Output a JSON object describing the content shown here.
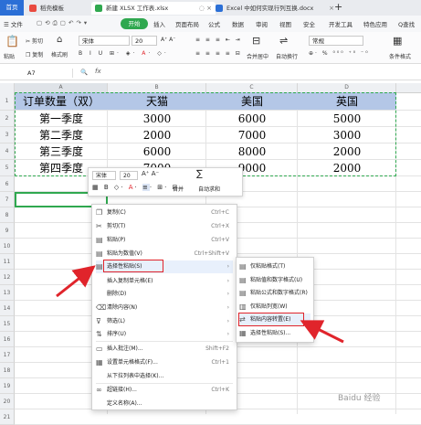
{
  "tabs": {
    "home": "首页",
    "wps": "稻壳模板",
    "xlsx": "新建 XLSX 工作表.xlsx",
    "docx": "Excel 中如何实现行列互换.docx",
    "plus": "+"
  },
  "menubar": {
    "file": "☰ 文件",
    "start": "开始",
    "items": [
      "插入",
      "页面布局",
      "公式",
      "数据",
      "审阅",
      "视图",
      "安全",
      "开发工具",
      "特色应用",
      "Q查找"
    ]
  },
  "ribbon": {
    "paste": "粘贴",
    "cut": "剪切",
    "copy": "复制",
    "format_painter": "格式刷",
    "font": "宋体",
    "font_size": "20",
    "merge": "合并居中",
    "wrap": "自动换行",
    "number_format": "常规",
    "cond": "条件格式"
  },
  "formula_bar": {
    "cell_ref": "A7",
    "fx": "fx"
  },
  "columns": [
    "A",
    "B",
    "C",
    "D"
  ],
  "rows": [
    "1",
    "2",
    "3",
    "4",
    "5",
    "6",
    "7",
    "8",
    "9",
    "10",
    "11",
    "12",
    "13",
    "14",
    "15",
    "16",
    "17",
    "18",
    "19",
    "20",
    "21"
  ],
  "table": {
    "headers": [
      "订单数量（双）",
      "天猫",
      "美国",
      "英国"
    ],
    "data": [
      [
        "第一季度",
        "3000",
        "6000",
        "5000"
      ],
      [
        "第二季度",
        "2000",
        "7000",
        "3000"
      ],
      [
        "第三季度",
        "6000",
        "8000",
        "2000"
      ],
      [
        "第四季度",
        "7000",
        "9000",
        "2000"
      ]
    ]
  },
  "mini_toolbar": {
    "font": "宋体",
    "size": "20",
    "merge": "合并",
    "autosum": "自动求和"
  },
  "context_menu": [
    {
      "label": "复制(C)",
      "shortcut": "Ctrl+C",
      "icon": "copy-icon"
    },
    {
      "label": "剪切(T)",
      "shortcut": "Ctrl+X",
      "icon": "cut-icon"
    },
    {
      "label": "粘贴(P)",
      "shortcut": "Ctrl+V",
      "icon": "paste-icon"
    },
    {
      "label": "粘贴为数值(V)",
      "shortcut": "Ctrl+Shift+V",
      "icon": "paste-values-icon"
    },
    {
      "label": "选择性粘贴(S)",
      "shortcut": "",
      "icon": "paste-special-icon",
      "submenu": true
    },
    {
      "label": "插入复制单元格(E)",
      "shortcut": "",
      "icon": "",
      "submenu": true
    },
    {
      "label": "删除(D)",
      "shortcut": "",
      "icon": "",
      "submenu": true
    },
    {
      "label": "清除内容(N)",
      "shortcut": "",
      "icon": "eraser-icon",
      "submenu": true
    },
    {
      "label": "筛选(L)",
      "shortcut": "",
      "icon": "filter-icon",
      "submenu": true
    },
    {
      "label": "排序(U)",
      "shortcut": "",
      "icon": "sort-icon",
      "submenu": true
    },
    {
      "label": "插入批注(M)...",
      "shortcut": "Shift+F2",
      "icon": "comment-icon"
    },
    {
      "label": "设置单元格格式(F)...",
      "shortcut": "Ctrl+1",
      "icon": "format-cells-icon"
    },
    {
      "label": "从下拉列表中选择(K)...",
      "shortcut": "",
      "icon": ""
    },
    {
      "label": "超链接(H)...",
      "shortcut": "Ctrl+K",
      "icon": "link-icon"
    },
    {
      "label": "定义名称(A)...",
      "shortcut": "",
      "icon": ""
    }
  ],
  "submenu": [
    {
      "label": "仅粘贴格式(T)",
      "icon": "paste-format-icon"
    },
    {
      "label": "粘贴值和数字格式(U)",
      "icon": "paste-values-format-icon"
    },
    {
      "label": "粘贴公式和数字格式(R)",
      "icon": "paste-formula-icon"
    },
    {
      "label": "仅粘贴列宽(W)",
      "icon": "paste-width-icon"
    },
    {
      "label": "粘贴内容转置(E)",
      "icon": "transpose-icon"
    },
    {
      "label": "选择性粘贴(S)...",
      "icon": "paste-special-icon"
    }
  ],
  "colors": {
    "accent": "#2b6fd6",
    "highlight": "#e0242b",
    "header_fill": "#b4c7e7",
    "selection": "#2fa84f"
  }
}
